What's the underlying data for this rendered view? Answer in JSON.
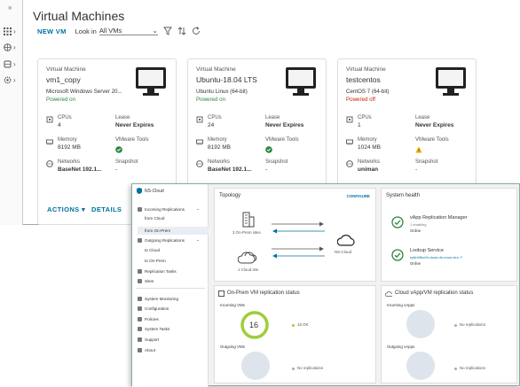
{
  "back": {
    "title": "Virtual Machines",
    "new_vm": "NEW VM",
    "look_in_label": "Look in",
    "look_in_value": "All VMs",
    "rail_expand": "»",
    "cards": [
      {
        "type": "Virtual Machine",
        "name": "vm1_copy",
        "os": "Microsoft Windows Server 20...",
        "status": "Powered on",
        "status_color": "#2e8540",
        "cpus_label": "CPUs",
        "cpus": "4",
        "lease_label": "Lease",
        "lease": "Never Expires",
        "memory_label": "Memory",
        "memory": "8192 MB",
        "tools_label": "VMware Tools",
        "tools_state": "ok",
        "networks_label": "Networks",
        "networks": "BaseNet 192.1...",
        "snapshot_label": "Snapshot",
        "snapshot": "-",
        "actions": "ACTIONS ▾",
        "details": "DETAILS"
      },
      {
        "type": "Virtual Machine",
        "name": "Ubuntu-18.04 LTS",
        "os": "Ubuntu Linux (64-bit)",
        "status": "Powered on",
        "status_color": "#2e8540",
        "cpus_label": "CPUs",
        "cpus": "24",
        "lease_label": "Lease",
        "lease": "Never Expires",
        "memory_label": "Memory",
        "memory": "8192 MB",
        "tools_label": "VMware Tools",
        "tools_state": "ok",
        "networks_label": "Networks",
        "networks": "BaseNet 192.1...",
        "snapshot_label": "Snapshot",
        "snapshot": "-"
      },
      {
        "type": "Virtual Machine",
        "name": "testcentos",
        "os": "CentOS 7 (64-bit)",
        "status": "Powered off",
        "status_color": "#c92100",
        "cpus_label": "CPUs",
        "cpus": "1",
        "lease_label": "Lease",
        "lease": "Never Expires",
        "memory_label": "Memory",
        "memory": "1024 MB",
        "tools_label": "VMware Tools",
        "tools_state": "warn",
        "networks_label": "Networks",
        "networks": "uniman",
        "snapshot_label": "Snapshot",
        "snapshot": "-"
      }
    ]
  },
  "front": {
    "logo": "NS-Cloud",
    "nav": [
      {
        "label": "Incoming Replications",
        "chev": "⌄"
      },
      {
        "label": "from Cloud"
      },
      {
        "label": "from On-Prem"
      },
      {
        "label": "Outgoing Replications",
        "chev": "⌄"
      },
      {
        "label": "to Cloud"
      },
      {
        "label": "to On-Prem"
      },
      {
        "label": "Replication Tasks"
      },
      {
        "label": "Sites"
      },
      {
        "label": "System Monitoring"
      },
      {
        "label": "Configuration"
      },
      {
        "label": "Policies"
      },
      {
        "label": "System Tasks"
      },
      {
        "label": "Support"
      },
      {
        "label": "About"
      }
    ],
    "topology": {
      "title": "Topology",
      "configure": "CONFIGURE",
      "onprem_sites": "3 On-Prem sites",
      "cloud_site": "1 Cloud site",
      "ns_cloud": "NS-Cloud"
    },
    "health": {
      "title": "System health",
      "items": [
        {
          "name": "vApp Replication Manager",
          "sub": "1 enabling",
          "state": "Online"
        },
        {
          "name": "Lookup Service",
          "sub": "sy6n9fbxr9r.cloud.de-muxx.bra ↗",
          "state": "Online"
        }
      ]
    },
    "onprem": {
      "title": "On-Prem VM replication status",
      "incoming": "Incoming VMs",
      "count": "16",
      "ok": "16 OK",
      "outgoing": "Outgoing VMs",
      "none": "No replications"
    },
    "cloud": {
      "title": "Cloud vApp/VM replication status",
      "incoming": "Incoming vApps",
      "none_in": "No replications",
      "outgoing": "Outgoing vApps",
      "none_out": "No replications"
    }
  }
}
